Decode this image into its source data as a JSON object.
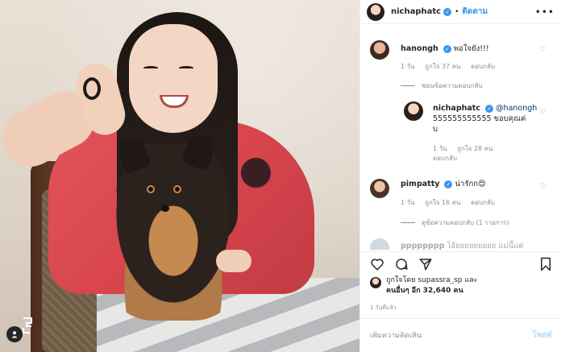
{
  "post": {
    "username": "nichaphatc",
    "follow_label": "ติดตาม",
    "more_label": "•••"
  },
  "comments": [
    {
      "username": "hanongh",
      "text": "พอใจยัง!!!",
      "time": "1 วัน",
      "likes": "ถูกใจ 37 คน",
      "reply": "ตอบกลับ",
      "replies_toggle": "ซ่อนข้อความตอบกลับ"
    },
    {
      "username": "nichaphatc",
      "mention": "@hanongh",
      "text_line1": "555555555555 ขอบคุณค่",
      "text_line2": "บ",
      "time": "1 วัน",
      "likes": "ถูกใจ 28 คน",
      "reply": "ตอบกลับ"
    },
    {
      "username": "pimpatty",
      "text": "น่ารักก😍",
      "time": "1 วัน",
      "likes": "ถูกใจ 16 คน",
      "reply": "ตอบกลับ",
      "replies_toggle": "ดูข้อความตอบกลับ (1 รายการ)"
    },
    {
      "username": "pppppppp",
      "text": "โอ้ยยยยยยยยย แม่นี้แต่"
    }
  ],
  "likes_line1": "ถูกใจโดย supassra_sp และ",
  "likes_line2": "คนอื่นๆ อีก 32,640 คน",
  "time_ago": "1 วันที่แล้ว",
  "comment_placeholder": "เพิ่มความคิดเห็น",
  "post_button": "โพสต์",
  "icons": {
    "verified": "verified-badge-icon",
    "heart": "heart-icon",
    "comment": "comment-icon",
    "share": "share-icon",
    "save": "bookmark-icon"
  },
  "colors": {
    "accent": "#3897f0",
    "muted": "#8e8e8e",
    "post_disabled": "#b2dffc"
  }
}
